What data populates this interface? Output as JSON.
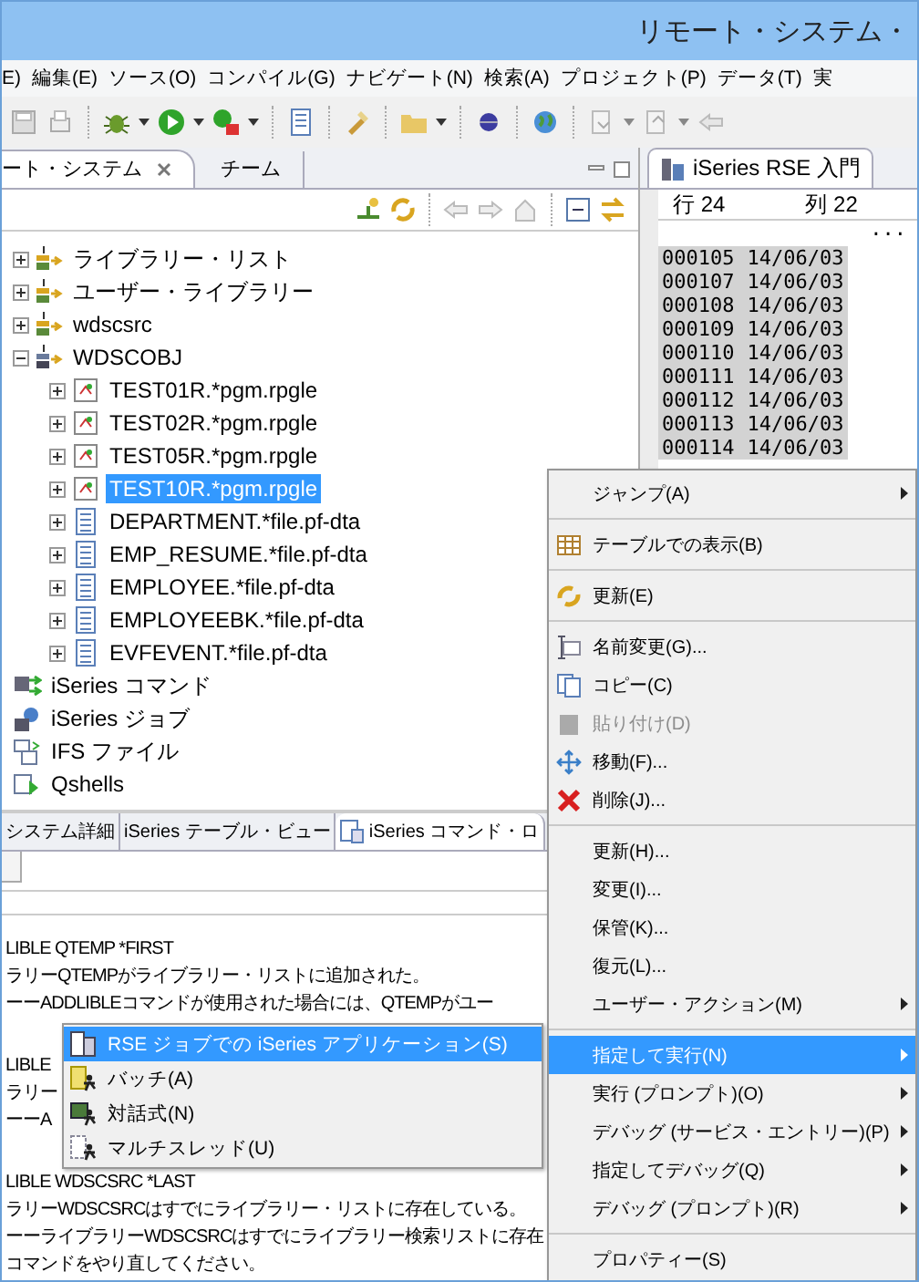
{
  "window": {
    "title": "リモート・システム・"
  },
  "menubar": [
    "E)",
    "編集(E)",
    "ソース(O)",
    "コンパイル(G)",
    "ナビゲート(N)",
    "検索(A)",
    "プロジェクト(P)",
    "データ(T)",
    "実"
  ],
  "left_view": {
    "tabs": [
      {
        "label": "ート・システム",
        "selected": true
      },
      {
        "label": "チーム",
        "selected": false
      }
    ]
  },
  "tree": [
    {
      "label": "ライブラリー・リスト",
      "kind": "library",
      "expanded": false,
      "selected": false
    },
    {
      "label": "ユーザー・ライブラリー",
      "kind": "library",
      "expanded": false,
      "selected": false
    },
    {
      "label": "wdscsrc",
      "kind": "library",
      "expanded": false,
      "selected": false
    },
    {
      "label": "WDSCOBJ",
      "kind": "library-object",
      "expanded": true,
      "selected": false,
      "children": [
        {
          "label": "TEST01R.*pgm.rpgle",
          "kind": "program",
          "expanded": false,
          "selected": false
        },
        {
          "label": "TEST02R.*pgm.rpgle",
          "kind": "program",
          "expanded": false,
          "selected": false
        },
        {
          "label": "TEST05R.*pgm.rpgle",
          "kind": "program",
          "expanded": false,
          "selected": false
        },
        {
          "label": "TEST10R.*pgm.rpgle",
          "kind": "program",
          "expanded": false,
          "selected": true
        },
        {
          "label": "DEPARTMENT.*file.pf-dta",
          "kind": "file",
          "expanded": false,
          "selected": false
        },
        {
          "label": "EMP_RESUME.*file.pf-dta",
          "kind": "file",
          "expanded": false,
          "selected": false
        },
        {
          "label": "EMPLOYEE.*file.pf-dta",
          "kind": "file",
          "expanded": false,
          "selected": false
        },
        {
          "label": "EMPLOYEEBK.*file.pf-dta",
          "kind": "file",
          "expanded": false,
          "selected": false
        },
        {
          "label": "EVFEVENT.*file.pf-dta",
          "kind": "file",
          "expanded": false,
          "selected": false
        }
      ]
    },
    {
      "label": "iSeries コマンド",
      "kind": "commands",
      "selected": false
    },
    {
      "label": "iSeries ジョブ",
      "kind": "jobs",
      "selected": false
    },
    {
      "label": "IFS ファイル",
      "kind": "ifs",
      "selected": false
    },
    {
      "label": "Qshells",
      "kind": "qshell",
      "selected": false
    }
  ],
  "bottom_view": {
    "tabs": [
      {
        "label": "システム詳細",
        "selected": false
      },
      {
        "label": "iSeries テーブル・ビュー",
        "selected": false
      },
      {
        "label": "iSeries コマンド・ロ",
        "selected": true
      }
    ],
    "log": [
      [
        "LIBLE QTEMP *FIRST",
        "ラリーQTEMPがライブラリー・リストに追加された。",
        "ーーADDLIBLEコマンドが使用された場合には、QTEMPがユー"
      ],
      [
        "LIBLE",
        "ラリー",
        "ーーA"
      ],
      [
        "LIBLE WDSCSRC *LAST",
        "ラリーWDSCSRCはすでにライブラリー・リストに存在している。",
        "ーーライブラリーWDSCSRCはすでにライブラリー検索リストに存在",
        "コマンドをやり直してください。"
      ]
    ]
  },
  "editor": {
    "tab": "iSeries RSE 入門",
    "row_label": "行 24",
    "col_label": "列 22",
    "ellipsis": "...",
    "lines": [
      {
        "seq": "000105",
        "date": "14/06/03"
      },
      {
        "seq": "000107",
        "date": "14/06/03"
      },
      {
        "seq": "000108",
        "date": "14/06/03"
      },
      {
        "seq": "000109",
        "date": "14/06/03"
      },
      {
        "seq": "000110",
        "date": "14/06/03"
      },
      {
        "seq": "000111",
        "date": "14/06/03"
      },
      {
        "seq": "000112",
        "date": "14/06/03"
      },
      {
        "seq": "000113",
        "date": "14/06/03"
      },
      {
        "seq": "000114",
        "date": "14/06/03"
      }
    ]
  },
  "context_menu": [
    {
      "kind": "plain",
      "label": "ジャンプ(A)",
      "submenu": true,
      "disabled": false,
      "selected": false
    },
    {
      "kind": "separator"
    },
    {
      "kind": "table",
      "label": "テーブルでの表示(B)",
      "submenu": false,
      "disabled": false,
      "selected": false
    },
    {
      "kind": "separator"
    },
    {
      "kind": "refresh",
      "label": "更新(E)",
      "submenu": false,
      "disabled": false,
      "selected": false
    },
    {
      "kind": "separator"
    },
    {
      "kind": "rename",
      "label": "名前変更(G)...",
      "submenu": false,
      "disabled": false,
      "selected": false
    },
    {
      "kind": "copy",
      "label": "コピー(C)",
      "submenu": false,
      "disabled": false,
      "selected": false
    },
    {
      "kind": "paste",
      "label": "貼り付け(D)",
      "submenu": false,
      "disabled": true,
      "selected": false
    },
    {
      "kind": "move",
      "label": "移動(F)...",
      "submenu": false,
      "disabled": false,
      "selected": false
    },
    {
      "kind": "delete",
      "label": "削除(J)...",
      "submenu": false,
      "disabled": false,
      "selected": false
    },
    {
      "kind": "separator"
    },
    {
      "kind": "plain",
      "label": "更新(H)...",
      "submenu": false,
      "disabled": false,
      "selected": false
    },
    {
      "kind": "plain",
      "label": "変更(I)...",
      "submenu": false,
      "disabled": false,
      "selected": false
    },
    {
      "kind": "plain",
      "label": "保管(K)...",
      "submenu": false,
      "disabled": false,
      "selected": false
    },
    {
      "kind": "plain",
      "label": "復元(L)...",
      "submenu": false,
      "disabled": false,
      "selected": false
    },
    {
      "kind": "plain",
      "label": "ユーザー・アクション(M)",
      "submenu": true,
      "disabled": false,
      "selected": false
    },
    {
      "kind": "separator"
    },
    {
      "kind": "plain",
      "label": "指定して実行(N)",
      "submenu": true,
      "disabled": false,
      "selected": true
    },
    {
      "kind": "plain",
      "label": "実行 (プロンプト)(O)",
      "submenu": true,
      "disabled": false,
      "selected": false
    },
    {
      "kind": "plain",
      "label": "デバッグ (サービス・エントリー)(P)",
      "submenu": true,
      "disabled": false,
      "selected": false
    },
    {
      "kind": "plain",
      "label": "指定してデバッグ(Q)",
      "submenu": true,
      "disabled": false,
      "selected": false
    },
    {
      "kind": "plain",
      "label": "デバッグ (プロンプト)(R)",
      "submenu": true,
      "disabled": false,
      "selected": false
    },
    {
      "kind": "separator"
    },
    {
      "kind": "plain",
      "label": "プロパティー(S)",
      "submenu": false,
      "disabled": false,
      "selected": false
    }
  ],
  "submenu": [
    {
      "kind": "rse-job",
      "label": "RSE ジョブでの iSeries アプリケーション(S)",
      "selected": true
    },
    {
      "kind": "batch",
      "label": "バッチ(A)",
      "selected": false
    },
    {
      "kind": "interactive",
      "label": "対話式(N)",
      "selected": false
    },
    {
      "kind": "multithread",
      "label": "マルチスレッド(U)",
      "selected": false
    }
  ]
}
